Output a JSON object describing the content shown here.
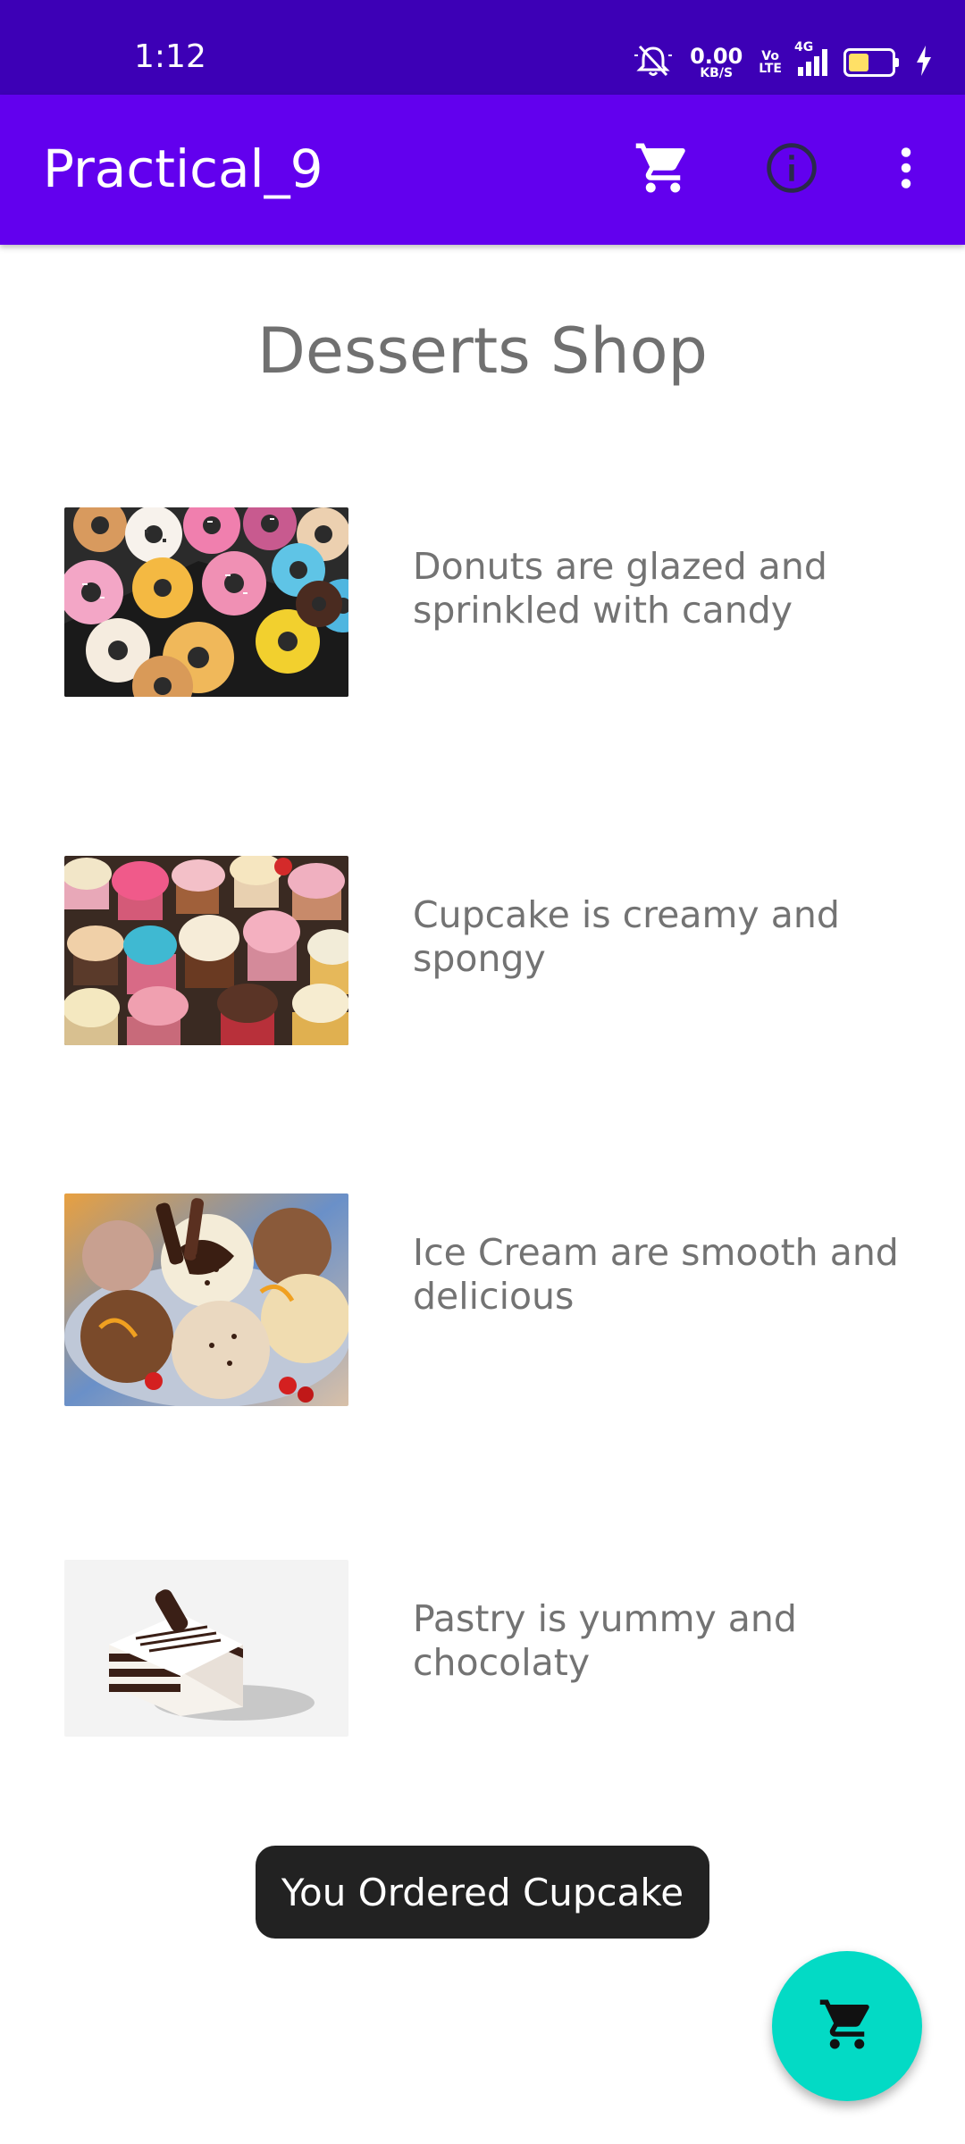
{
  "status_bar": {
    "time": "1:12",
    "net_speed_value": "0.00",
    "net_speed_unit": "KB/S",
    "volte_top": "Vo",
    "volte_bottom": "LTE",
    "network": "4G",
    "icons": [
      "mute-bell-icon",
      "signal-icon",
      "battery-icon",
      "charging-icon"
    ]
  },
  "app_bar": {
    "title": "Practical_9",
    "actions": [
      "cart-icon",
      "info-icon",
      "more-vert-icon"
    ]
  },
  "shop": {
    "title": "Desserts Shop",
    "items": [
      {
        "name": "Donuts",
        "description": "Donuts are glazed and sprinkled with candy"
      },
      {
        "name": "Cupcake",
        "description": "Cupcake is creamy and spongy"
      },
      {
        "name": "Ice Cream",
        "description": "Ice Cream are smooth and delicious"
      },
      {
        "name": "Pastry",
        "description": "Pastry is yummy and chocolaty"
      }
    ]
  },
  "toast": {
    "message": "You Ordered Cupcake"
  },
  "fab": {
    "icon": "cart-icon"
  },
  "colors": {
    "status_bar": "#3d00b6",
    "app_bar": "#6200ee",
    "fab": "#03dac5",
    "toast": "#222222",
    "text_gray": "#737373"
  }
}
